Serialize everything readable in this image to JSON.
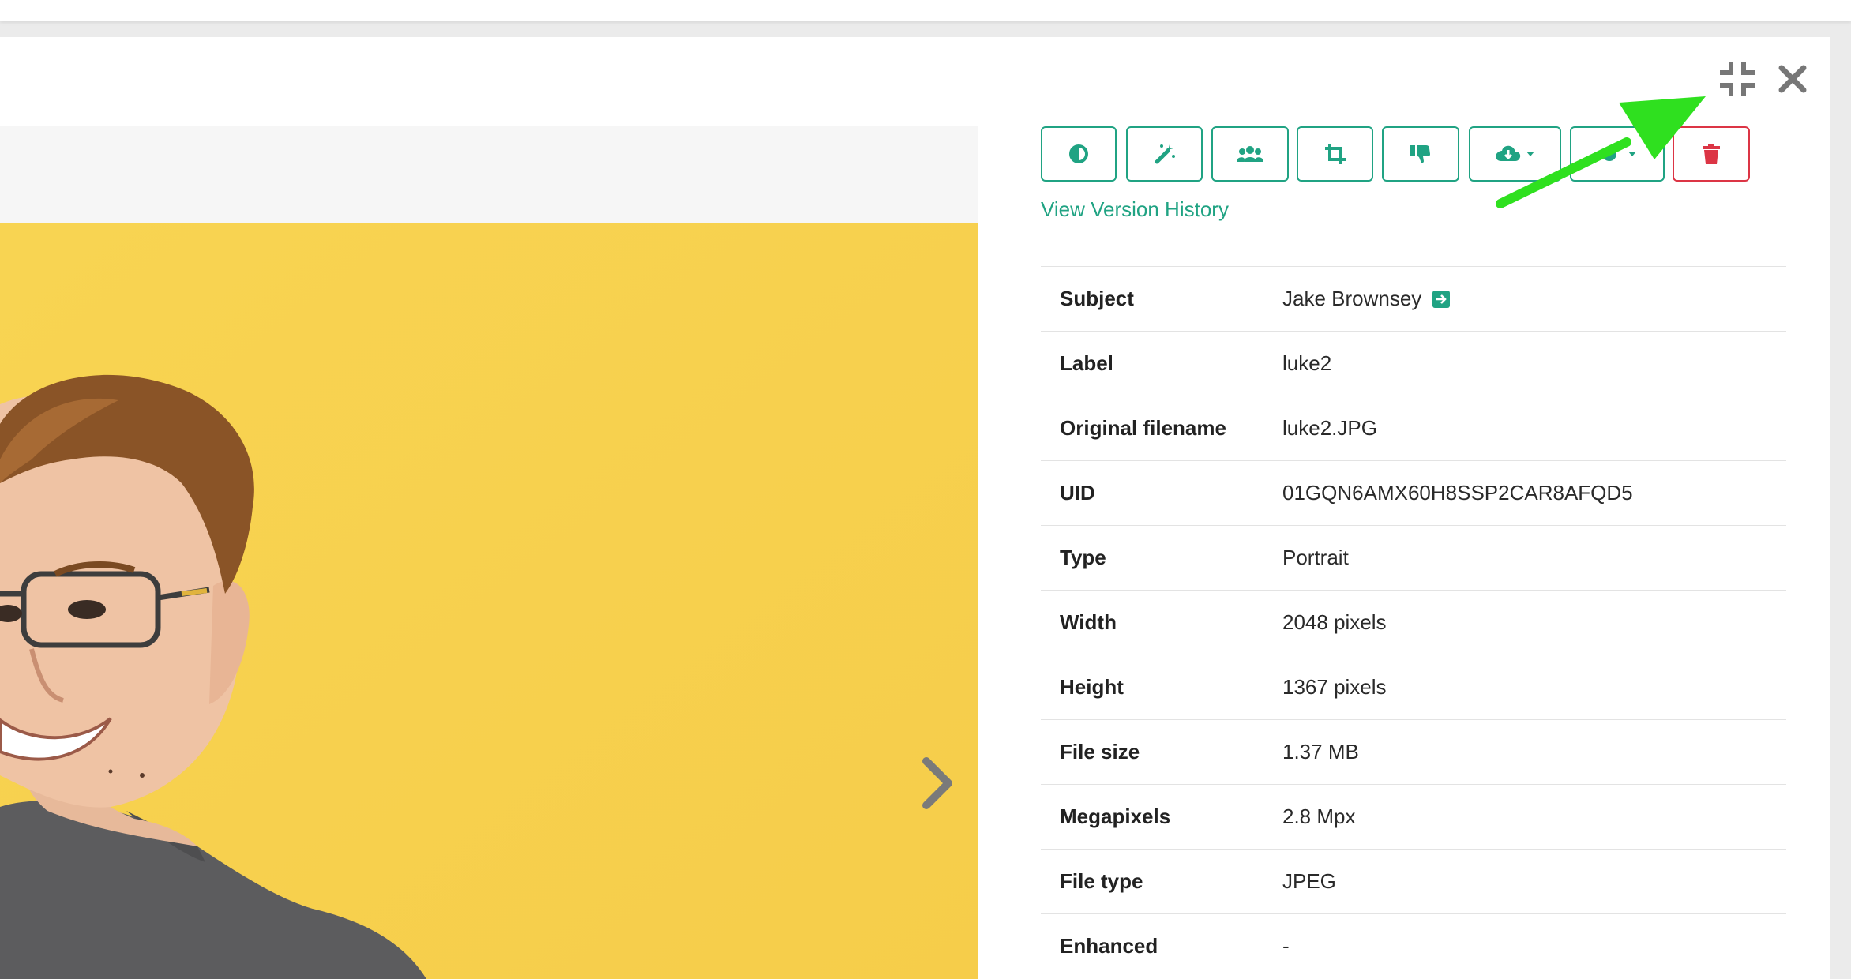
{
  "header": {
    "icons": [
      "compress-icon",
      "close-icon"
    ]
  },
  "toolbar": {
    "buttons": [
      {
        "icon": "contrast-icon",
        "style": "primary"
      },
      {
        "icon": "magic-wand-icon",
        "style": "primary"
      },
      {
        "icon": "people-icon",
        "style": "primary"
      },
      {
        "icon": "crop-icon",
        "style": "primary"
      },
      {
        "icon": "thumbs-down-icon",
        "style": "primary"
      },
      {
        "icon": "cloud-download-icon",
        "style": "primary",
        "has_dropdown": true
      },
      {
        "icon": "more-icon",
        "style": "primary",
        "has_dropdown": true
      },
      {
        "icon": "trash-icon",
        "style": "danger"
      }
    ],
    "version_history_label": "View Version History"
  },
  "details": {
    "rows": [
      {
        "key": "Subject",
        "value": "Jake Brownsey",
        "has_link": true
      },
      {
        "key": "Label",
        "value": "luke2"
      },
      {
        "key": "Original filename",
        "value": "luke2.JPG"
      },
      {
        "key": "UID",
        "value": "01GQN6AMX60H8SSP2CAR8AFQD5"
      },
      {
        "key": "Type",
        "value": "Portrait"
      },
      {
        "key": "Width",
        "value": "2048 pixels"
      },
      {
        "key": "Height",
        "value": "1367 pixels"
      },
      {
        "key": "File size",
        "value": "1.37 MB"
      },
      {
        "key": "Megapixels",
        "value": "2.8 Mpx"
      },
      {
        "key": "File type",
        "value": "JPEG"
      },
      {
        "key": "Enhanced",
        "value": "-"
      }
    ]
  },
  "colors": {
    "accent": "#20a383",
    "danger": "#dc3545",
    "photo_background": "#f7d04f",
    "annotation_arrow": "#2fe01f"
  }
}
